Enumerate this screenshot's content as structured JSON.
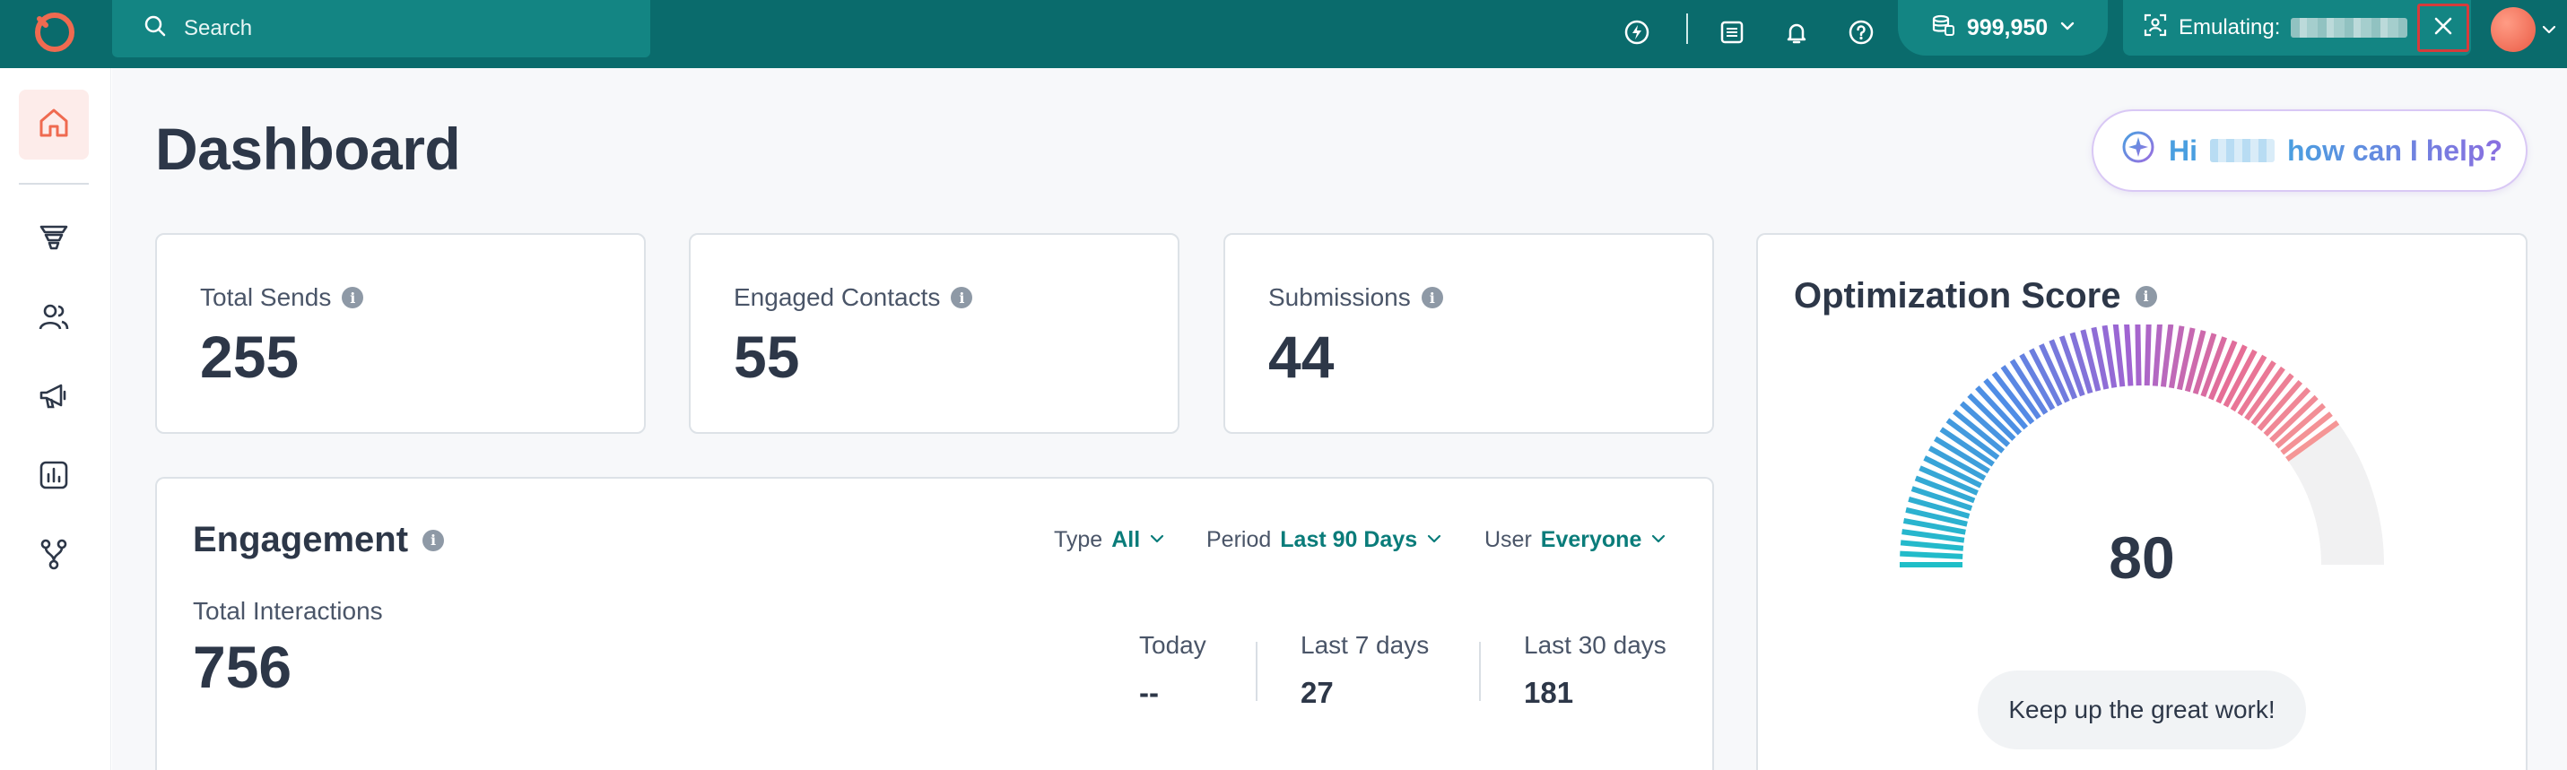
{
  "topbar": {
    "search_label": "Search",
    "credits": "999,950",
    "emulating_label": "Emulating:"
  },
  "page": {
    "title": "Dashboard"
  },
  "assistant": {
    "greeting": "Hi",
    "prompt": "how can I help?"
  },
  "stats": [
    {
      "label": "Total Sends",
      "value": "255"
    },
    {
      "label": "Engaged Contacts",
      "value": "55"
    },
    {
      "label": "Submissions",
      "value": "44"
    }
  ],
  "engagement": {
    "title": "Engagement",
    "filters": {
      "type_label": "Type",
      "type_value": "All",
      "period_label": "Period",
      "period_value": "Last 90 Days",
      "user_label": "User",
      "user_value": "Everyone"
    },
    "total_label": "Total Interactions",
    "total_value": "756",
    "periods": [
      {
        "label": "Today",
        "value": "--"
      },
      {
        "label": "Last 7 days",
        "value": "27"
      },
      {
        "label": "Last 30 days",
        "value": "181"
      }
    ]
  },
  "optimization": {
    "title": "Optimization Score",
    "score": "80",
    "score_max": 100,
    "message": "Keep up the great work!"
  },
  "colors": {
    "topbar": "#0a6b6c",
    "topbar_pill": "#138583",
    "accent": "#0a7c7a",
    "brand_orange": "#ef6a50",
    "highlight_red": "#d63b3b"
  },
  "icons": {
    "logo": "ring-logo-icon",
    "search": "search-icon",
    "spark": "lightning-bolt-icon",
    "notes": "document-list-icon",
    "bell": "bell-icon",
    "help": "question-circle-icon",
    "credits": "coin-stack-icon",
    "emulate": "user-scan-icon",
    "close": "close-icon",
    "home": "home-icon",
    "funnel": "funnel-icon",
    "contacts": "users-icon",
    "campaign": "megaphone-icon",
    "reports": "bar-chart-icon",
    "workflows": "workflow-icon",
    "ai": "sparkle-icon",
    "info": "info-icon"
  }
}
